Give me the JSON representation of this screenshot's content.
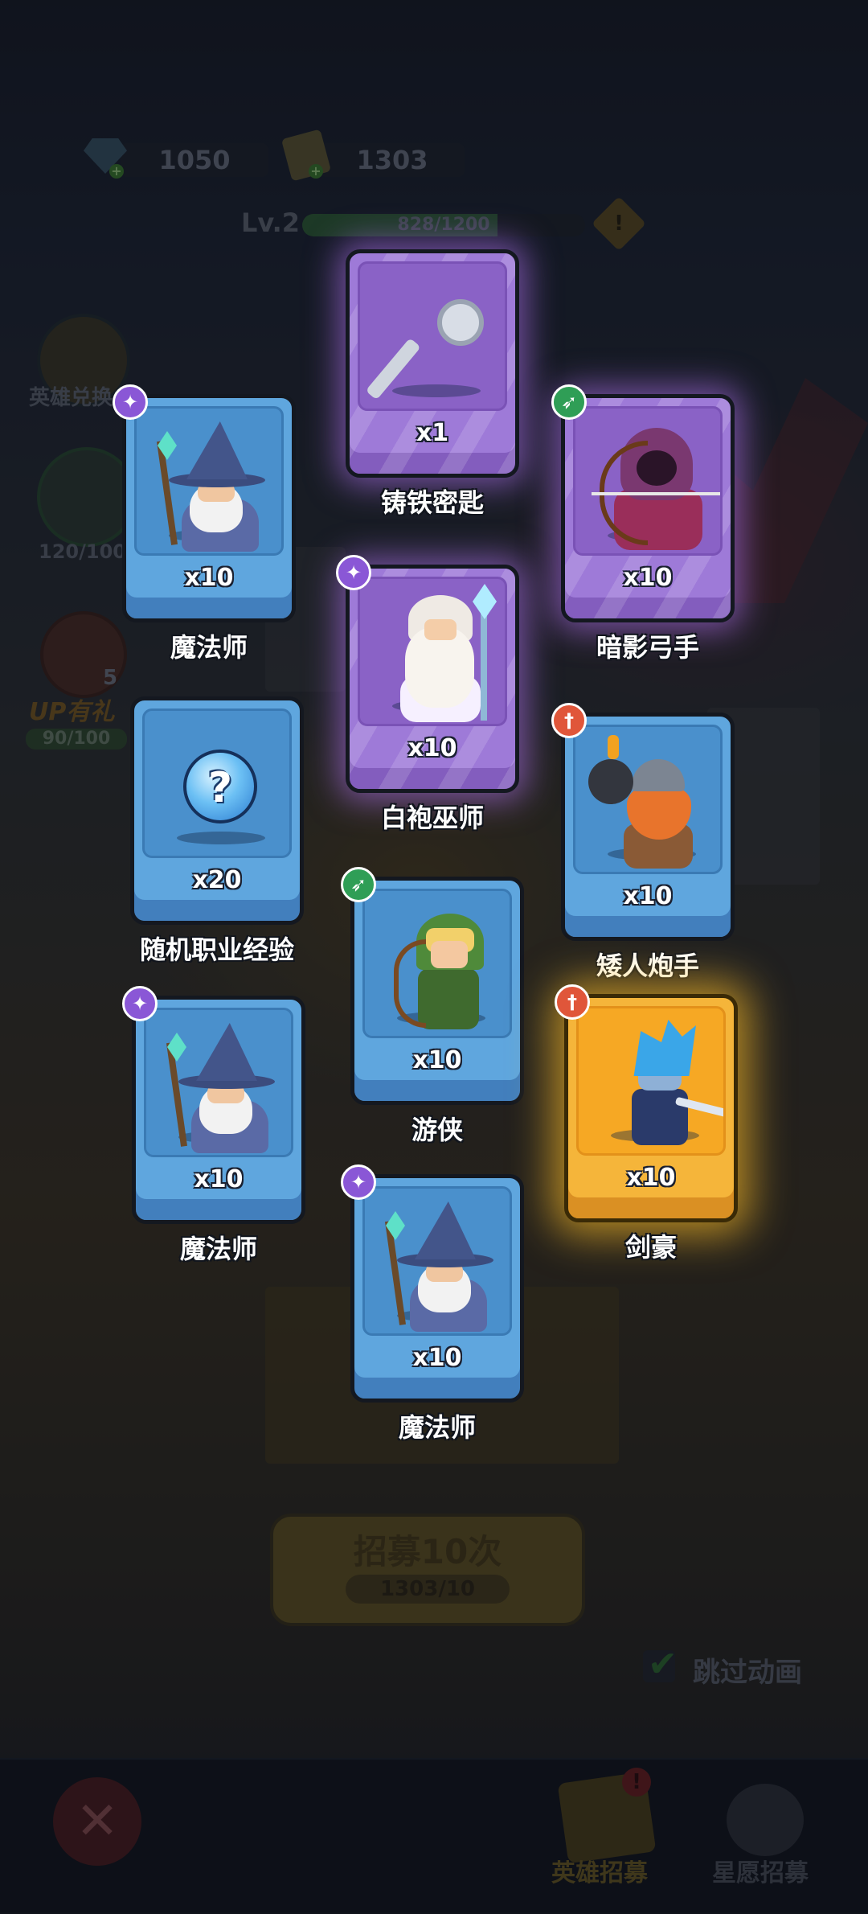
{
  "resources": {
    "gems": "1050",
    "tickets": "1303"
  },
  "player": {
    "level_label": "Lv.2",
    "xp_text": "828/1200",
    "xp_fraction": 0.69
  },
  "side_panel": {
    "hero_exchange_label": "英雄兑换",
    "progress_label": "120/100",
    "up_count": "5",
    "up_gift_label": "UP有礼",
    "up_progress": "90/100"
  },
  "rewards": [
    {
      "name": "魔法师",
      "qty": "x10",
      "rarity": "blue",
      "class_icon": "mage-staff-icon",
      "class_glyph": "✦",
      "figure": "wizard"
    },
    {
      "name": "铸铁密匙",
      "qty": "x1",
      "rarity": "purple",
      "class_icon": "",
      "class_glyph": "",
      "figure": "key"
    },
    {
      "name": "暗影弓手",
      "qty": "x10",
      "rarity": "purple",
      "class_icon": "ranger-bow-icon",
      "class_glyph": "➶",
      "figure": "shadow-archer"
    },
    {
      "name": "白袍巫师",
      "qty": "x10",
      "rarity": "purple",
      "class_icon": "mage-staff-icon",
      "class_glyph": "✦",
      "figure": "white-wizard"
    },
    {
      "name": "随机职业经验",
      "qty": "x20",
      "rarity": "blue",
      "class_icon": "",
      "class_glyph": "",
      "figure": "orb"
    },
    {
      "name": "矮人炮手",
      "qty": "x10",
      "rarity": "blue",
      "class_icon": "warrior-sword-icon",
      "class_glyph": "†",
      "figure": "dwarf"
    },
    {
      "name": "游侠",
      "qty": "x10",
      "rarity": "blue",
      "class_icon": "ranger-bow-icon",
      "class_glyph": "➶",
      "figure": "ranger"
    },
    {
      "name": "魔法师",
      "qty": "x10",
      "rarity": "blue",
      "class_icon": "mage-staff-icon",
      "class_glyph": "✦",
      "figure": "wizard"
    },
    {
      "name": "剑豪",
      "qty": "x10",
      "rarity": "gold",
      "class_icon": "warrior-sword-icon",
      "class_glyph": "†",
      "figure": "swordmaster"
    },
    {
      "name": "魔法师",
      "qty": "x10",
      "rarity": "blue",
      "class_icon": "mage-staff-icon",
      "class_glyph": "✦",
      "figure": "wizard"
    }
  ],
  "summon": {
    "button_label": "招募10次",
    "cost_text": "1303/10"
  },
  "skip_animation_label": "跳过动画",
  "bottom_tabs": {
    "hero_recruit": "英雄招募",
    "star_wish_recruit": "星愿招募",
    "notif_glyph": "!"
  },
  "colors": {
    "card_blue": "#5fa6de",
    "card_purple": "#9e7ad8",
    "card_gold": "#f5b53a"
  }
}
